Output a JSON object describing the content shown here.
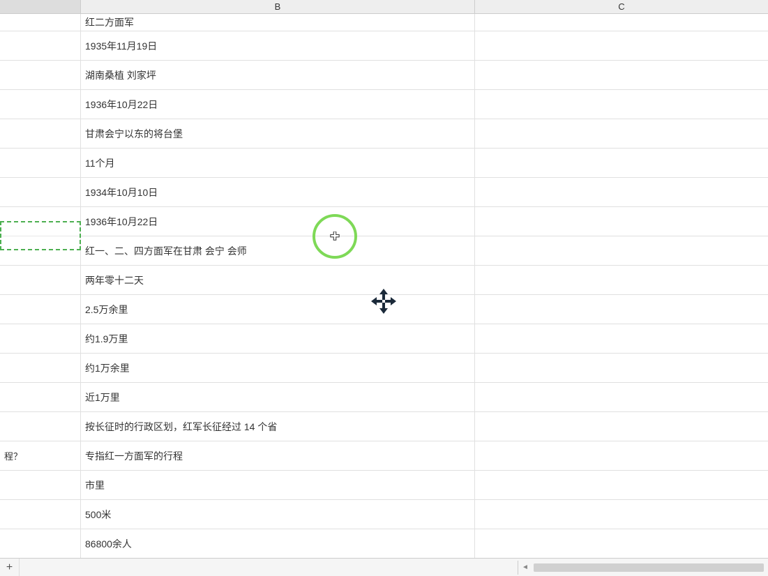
{
  "columns": {
    "a": "",
    "b": "B",
    "c": "C"
  },
  "rows": [
    {
      "a": "",
      "b": "红二方面军"
    },
    {
      "a": "",
      "b": "1935年11月19日"
    },
    {
      "a": "",
      "b": "湖南桑植  刘家坪"
    },
    {
      "a": "",
      "b": "1936年10月22日"
    },
    {
      "a": "",
      "b": "甘肃会宁以东的将台堡"
    },
    {
      "a": "",
      "b": "11个月"
    },
    {
      "a": "",
      "b": "1934年10月10日"
    },
    {
      "a": "",
      "b": "1936年10月22日"
    },
    {
      "a": "",
      "b": "红一、二、四方面军在甘肃  会宁  会师"
    },
    {
      "a": "",
      "b": "两年零十二天"
    },
    {
      "a": "",
      "b": "2.5万余里"
    },
    {
      "a": "",
      "b": "约1.9万里"
    },
    {
      "a": "",
      "b": "约1万余里"
    },
    {
      "a": "",
      "b": "近1万里"
    },
    {
      "a": "",
      "b": "按长征时的行政区划，红军长征经过 14 个省"
    },
    {
      "a": "程？",
      "b": "专指红一方面军的行程"
    },
    {
      "a": "",
      "b": "市里"
    },
    {
      "a": "",
      "b": "500米"
    },
    {
      "a": "",
      "b": "86800余人"
    }
  ],
  "bottom": {
    "add": "+"
  }
}
